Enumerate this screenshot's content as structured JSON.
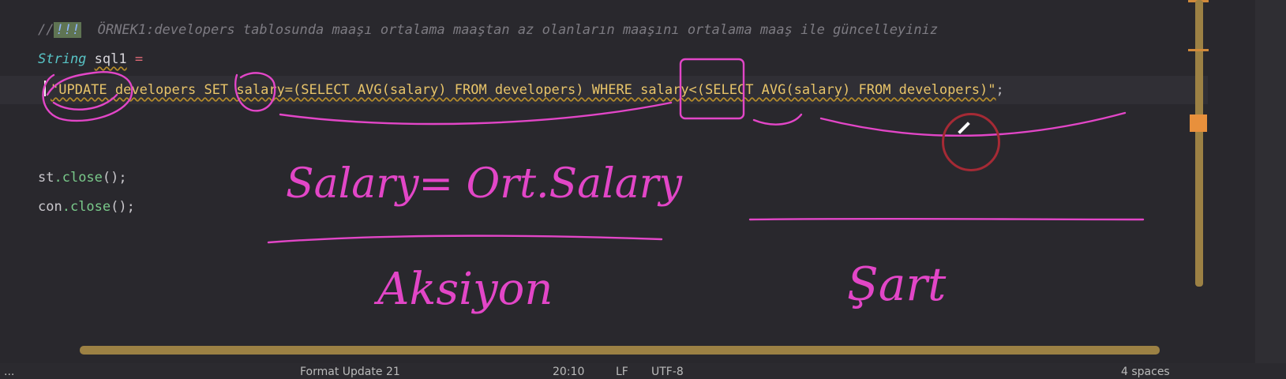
{
  "editor": {
    "comment": {
      "prefix": "//",
      "bang": "!!!",
      "text": "  ÖRNEK1:developers tablosunda maaşı ortalama maaştan az olanların maaşını ortalama maaş ile güncelleyiniz"
    },
    "decl": {
      "type": "String",
      "name": "sql1",
      "op": "="
    },
    "sql": {
      "string": "\"UPDATE developers SET salary=(SELECT AVG(salary) FROM developers) WHERE salary<(SELECT AVG(salary) FROM developers)\"",
      "semicolon": ";"
    },
    "close1": {
      "obj": "st",
      "method": ".close",
      "paren": "();"
    },
    "close2": {
      "obj": "con",
      "method": ".close",
      "paren": "();"
    }
  },
  "annotations": {
    "note1": "Salary= Ort.Salary",
    "note2": "Aksiyon",
    "note3": "Şart"
  },
  "colors": {
    "ink": "#e246c7",
    "background": "#29282d",
    "string": "#e8c469",
    "type_keyword": "#58c4c6"
  },
  "status_bar": {
    "text1": "...",
    "text2": "Format Update 21",
    "text3": "20:10",
    "text4": "LF",
    "text5": "UTF-8",
    "text6": "4 spaces"
  }
}
